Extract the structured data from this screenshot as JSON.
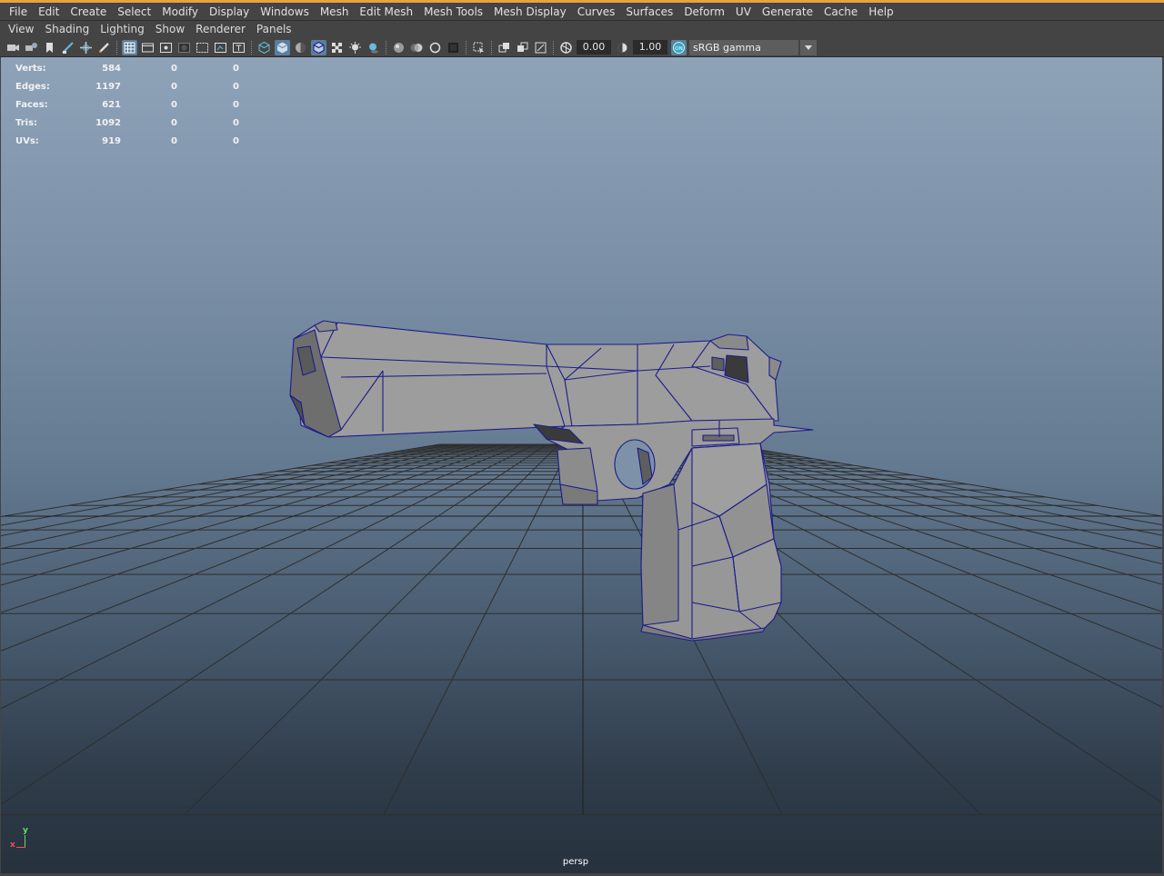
{
  "menubar": [
    "File",
    "Edit",
    "Create",
    "Select",
    "Modify",
    "Display",
    "Windows",
    "Mesh",
    "Edit Mesh",
    "Mesh Tools",
    "Mesh Display",
    "Curves",
    "Surfaces",
    "Deform",
    "UV",
    "Generate",
    "Cache",
    "Help"
  ],
  "panel_menu": [
    "View",
    "Shading",
    "Lighting",
    "Show",
    "Renderer",
    "Panels"
  ],
  "toolbar": {
    "exposure": "0.00",
    "gamma": "1.00",
    "color_space": "sRGB gamma",
    "gamma_toggle_icon": "on-toggle-icon"
  },
  "hud": {
    "rows": [
      {
        "label": "Verts:",
        "values": [
          "584",
          "0",
          "0"
        ]
      },
      {
        "label": "Edges:",
        "values": [
          "1197",
          "0",
          "0"
        ]
      },
      {
        "label": "Faces:",
        "values": [
          "621",
          "0",
          "0"
        ]
      },
      {
        "label": "Tris:",
        "values": [
          "1092",
          "0",
          "0"
        ]
      },
      {
        "label": "UVs:",
        "values": [
          "919",
          "0",
          "0"
        ]
      }
    ]
  },
  "viewport": {
    "camera": "persp",
    "axis_y": "y",
    "axis_x": "x"
  },
  "colors": {
    "accent": "#e8a33c",
    "wireframe": "#1c1c8a",
    "mesh": "#9a9a9a"
  }
}
